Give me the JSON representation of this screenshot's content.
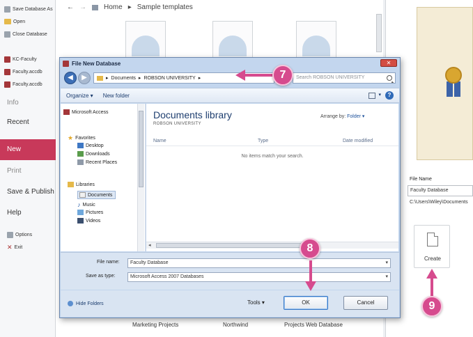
{
  "left_nav": {
    "recent": [
      {
        "label": "Save Database As",
        "icon": "save-icon"
      },
      {
        "label": "Open",
        "icon": "folder-icon"
      },
      {
        "label": "Close Database",
        "icon": "close-db-icon"
      },
      {
        "label": "KC-Faculty",
        "icon": "access-db-icon"
      },
      {
        "label": "Faculty.accdb",
        "icon": "access-db-icon"
      },
      {
        "label": "Faculty.accdb",
        "icon": "access-db-icon"
      }
    ],
    "info": "Info",
    "recent_label": "Recent",
    "new_label": "New",
    "print": "Print",
    "save_publish": "Save & Publish",
    "help": "Help",
    "options": "Options",
    "exit": "Exit"
  },
  "breadcrumb": {
    "back": "←",
    "forward": "→",
    "home": "Home",
    "sep": "▸",
    "current": "Sample templates"
  },
  "templates_bottom": [
    "Marketing Projects",
    "Northwind",
    "Projects Web Database"
  ],
  "right_panel": {
    "file_name_label": "File Name",
    "file_name_value": "Faculty Database",
    "path_value": "C:\\Users\\Wiley\\Documents",
    "create_label": "Create"
  },
  "dialog": {
    "title": "File New Database",
    "close": "✕",
    "address": [
      "Documents",
      "▸",
      "ROBSON UNIVERSITY",
      "▸"
    ],
    "search_placeholder": "Search ROBSON UNIVERSITY",
    "organize": "Organize ▾",
    "new_folder": "New folder",
    "help": "?",
    "view_caret": "▾",
    "nav": {
      "microsoft_access": "Microsoft Access",
      "favorites": "Favorites",
      "desktop": "Desktop",
      "downloads": "Downloads",
      "recent_places": "Recent Places",
      "libraries": "Libraries",
      "documents": "Documents",
      "music": "Music",
      "pictures": "Pictures",
      "videos": "Videos"
    },
    "library_title": "Documents library",
    "library_subtitle": "ROBSON UNIVERSITY",
    "arrange_by_label": "Arrange by:",
    "arrange_by_value": "Folder ▾",
    "columns": [
      "Name",
      "Type",
      "Date modified"
    ],
    "empty_message": "No items match your search.",
    "file_name_label": "File name:",
    "file_name_value": "Faculty Database",
    "save_type_label": "Save as type:",
    "save_type_value": "Microsoft Access 2007 Databases",
    "hide_folders": "Hide Folders",
    "tools": "Tools ▾",
    "ok": "OK",
    "cancel": "Cancel"
  },
  "callouts": {
    "seven": "7",
    "eight": "8",
    "nine": "9"
  },
  "colors": {
    "accent_pink": "#d64b8e",
    "backstage_new": "#c8395a",
    "dialog_frame": "#c3d6ee"
  }
}
